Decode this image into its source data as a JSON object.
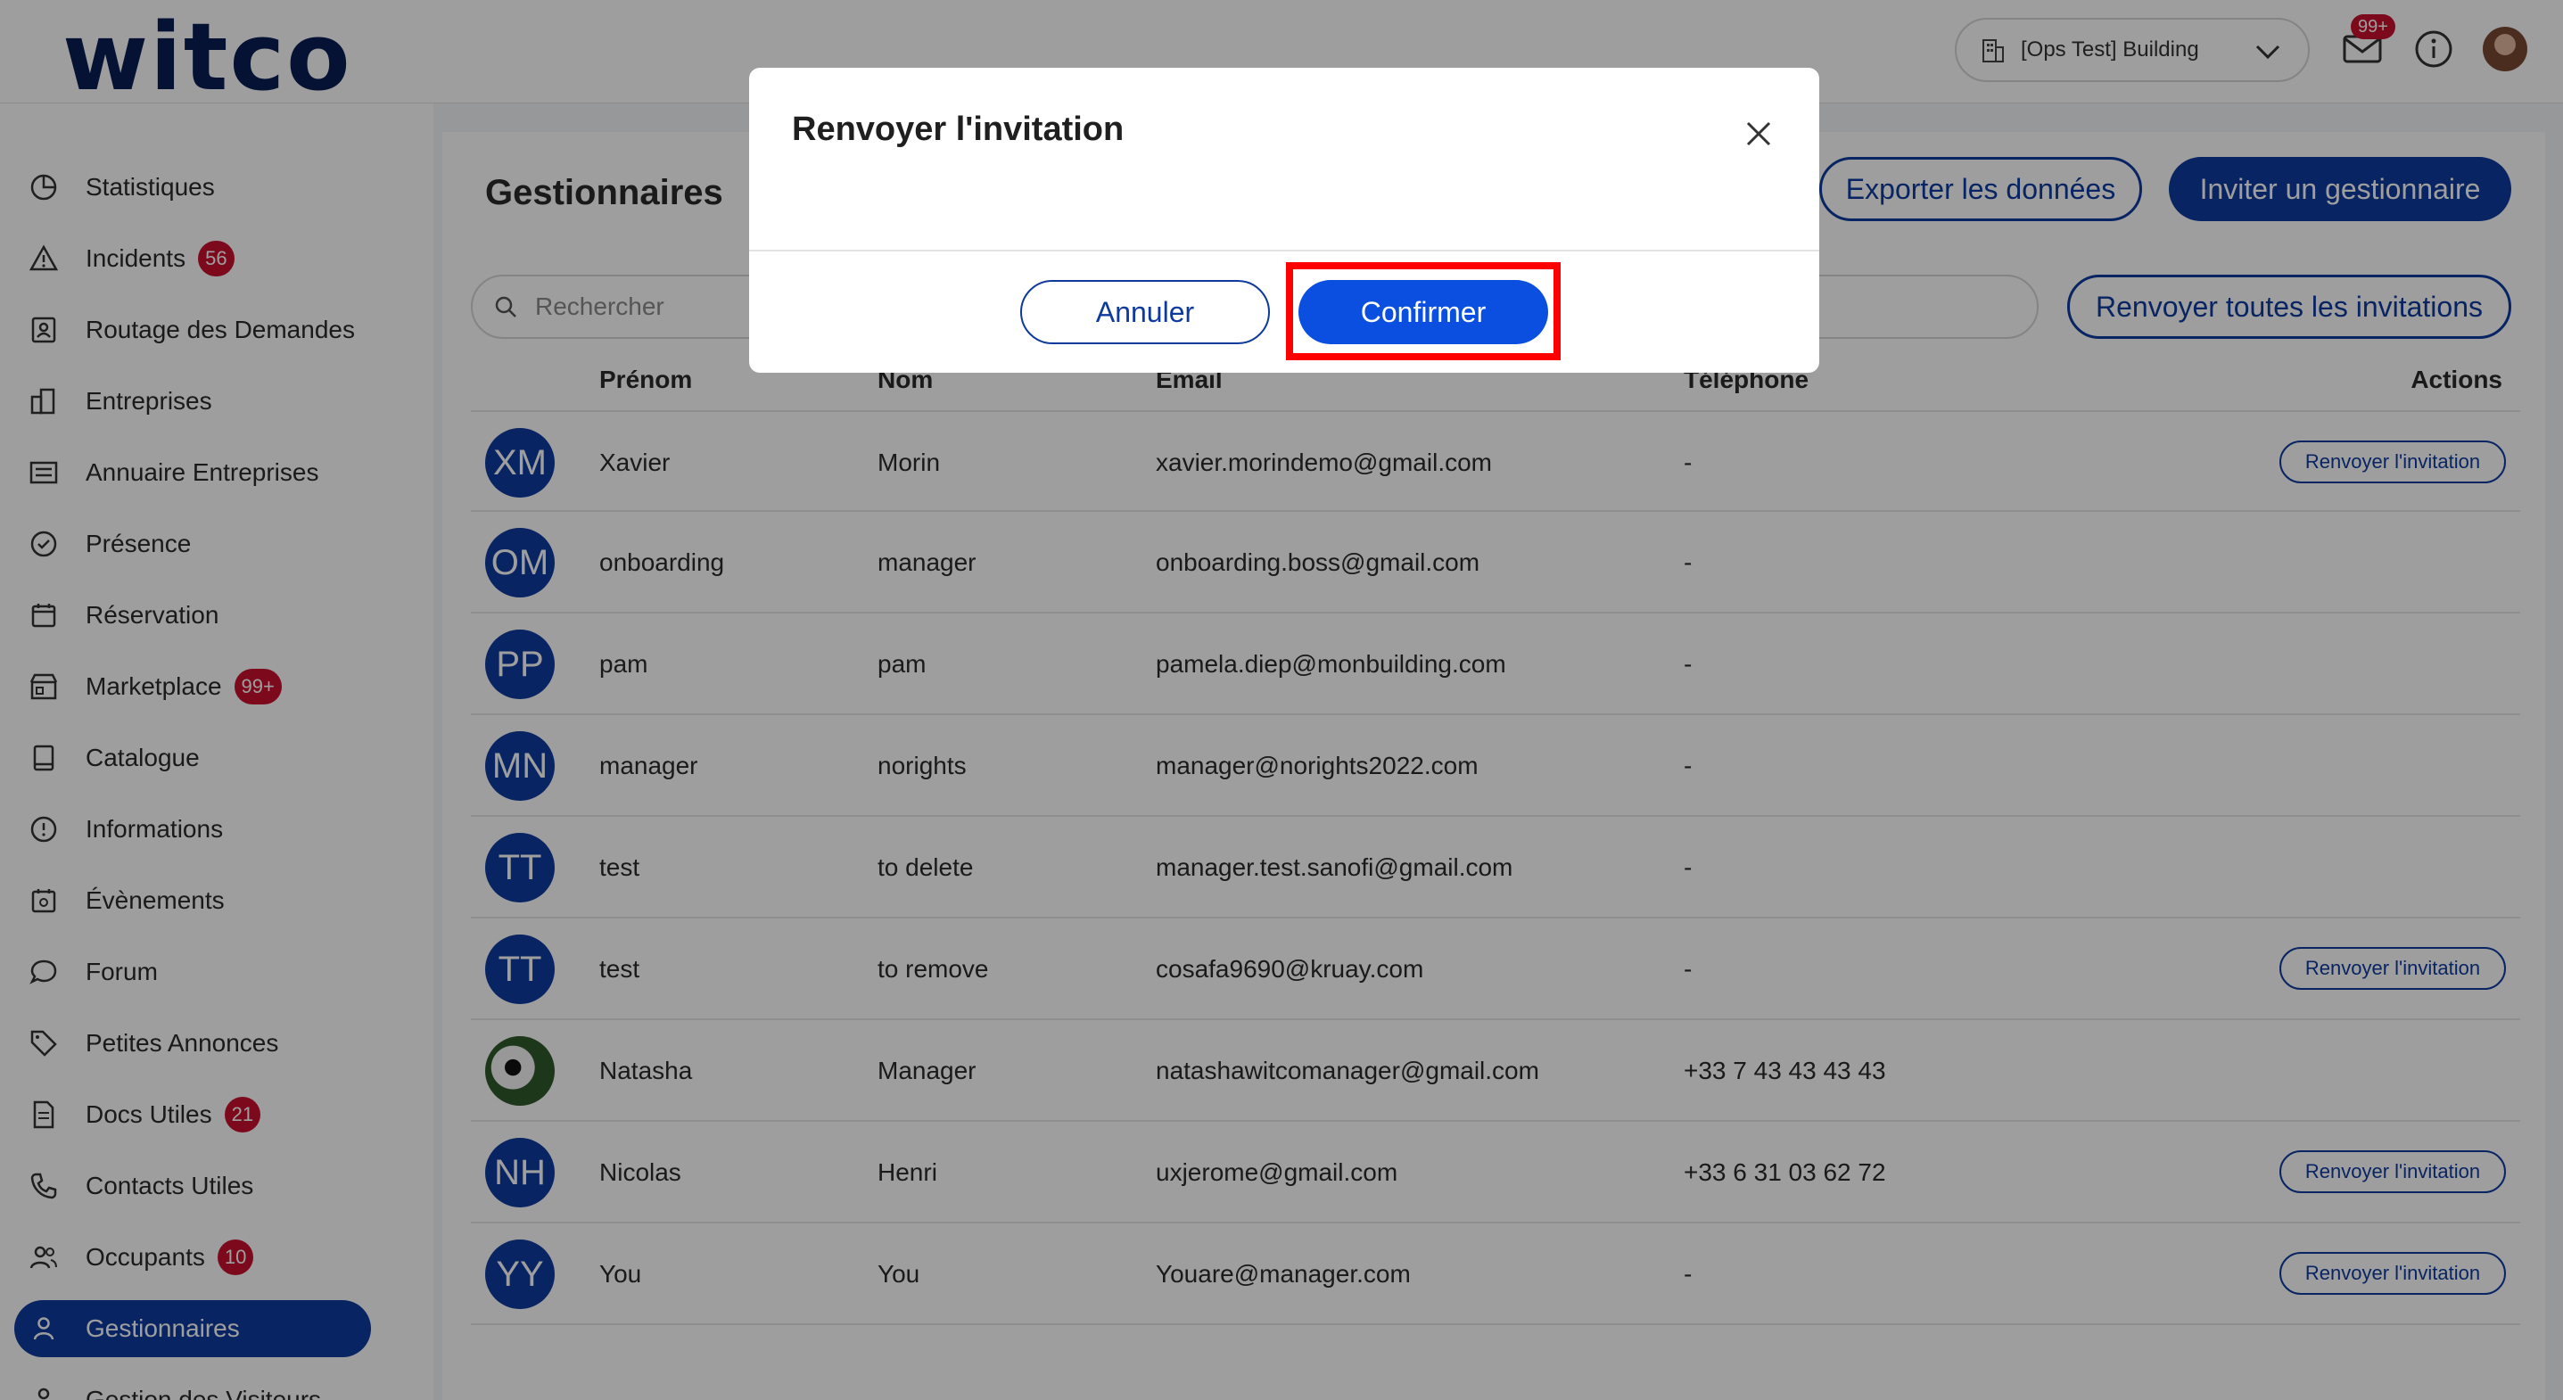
{
  "header": {
    "logo_text": "witco",
    "building": "[Ops Test] Building",
    "notifications_badge": "99+"
  },
  "sidebar": {
    "items": [
      {
        "label": "Statistiques",
        "badge": ""
      },
      {
        "label": "Incidents",
        "badge": "56"
      },
      {
        "label": "Routage des Demandes",
        "badge": ""
      },
      {
        "label": "Entreprises",
        "badge": ""
      },
      {
        "label": "Annuaire Entreprises",
        "badge": ""
      },
      {
        "label": "Présence",
        "badge": ""
      },
      {
        "label": "Réservation",
        "badge": ""
      },
      {
        "label": "Marketplace",
        "badge": "99+"
      },
      {
        "label": "Catalogue",
        "badge": ""
      },
      {
        "label": "Informations",
        "badge": ""
      },
      {
        "label": "Évènements",
        "badge": ""
      },
      {
        "label": "Forum",
        "badge": ""
      },
      {
        "label": "Petites Annonces",
        "badge": ""
      },
      {
        "label": "Docs Utiles",
        "badge": "21"
      },
      {
        "label": "Contacts Utiles",
        "badge": ""
      },
      {
        "label": "Occupants",
        "badge": "10"
      },
      {
        "label": "Gestionnaires",
        "badge": ""
      },
      {
        "label": "Gestion des Visiteurs",
        "badge": ""
      }
    ],
    "active_index": 16
  },
  "main": {
    "title": "Gestionnaires",
    "export_label": "Exporter les données",
    "invite_label": "Inviter un gestionnaire",
    "resend_all_label": "Renvoyer toutes les invitations",
    "search_placeholder": "Rechercher",
    "columns": {
      "first": "Prénom",
      "last": "Nom",
      "email": "Email",
      "phone": "Téléphone",
      "actions": "Actions"
    },
    "resend_label": "Renvoyer l'invitation",
    "rows": [
      {
        "initials": "XM",
        "first": "Xavier",
        "last": "Morin",
        "email": "xavier.morindemo@gmail.com",
        "phone": "-",
        "resend": true,
        "photo": false
      },
      {
        "initials": "OM",
        "first": "onboarding",
        "last": "manager",
        "email": "onboarding.boss@gmail.com",
        "phone": "-",
        "resend": false,
        "photo": false
      },
      {
        "initials": "PP",
        "first": "pam",
        "last": "pam",
        "email": "pamela.diep@monbuilding.com",
        "phone": "-",
        "resend": false,
        "photo": false
      },
      {
        "initials": "MN",
        "first": "manager",
        "last": "norights",
        "email": "manager@norights2022.com",
        "phone": "-",
        "resend": false,
        "photo": false
      },
      {
        "initials": "TT",
        "first": "test",
        "last": "to delete",
        "email": "manager.test.sanofi@gmail.com",
        "phone": "-",
        "resend": false,
        "photo": false
      },
      {
        "initials": "TT",
        "first": "test",
        "last": "to remove",
        "email": "cosafa9690@kruay.com",
        "phone": "-",
        "resend": true,
        "photo": false
      },
      {
        "initials": "",
        "first": "Natasha",
        "last": "Manager",
        "email": "natashawitcomanager@gmail.com",
        "phone": "+33 7 43 43 43 43",
        "resend": false,
        "photo": true
      },
      {
        "initials": "NH",
        "first": "Nicolas",
        "last": "Henri",
        "email": "uxjerome@gmail.com",
        "phone": "+33 6 31 03 62 72",
        "resend": true,
        "photo": false
      },
      {
        "initials": "YY",
        "first": "You",
        "last": "You",
        "email": "Youare@manager.com",
        "phone": "-",
        "resend": true,
        "photo": false
      }
    ]
  },
  "modal": {
    "title": "Renvoyer l'invitation",
    "cancel_label": "Annuler",
    "confirm_label": "Confirmer"
  }
}
